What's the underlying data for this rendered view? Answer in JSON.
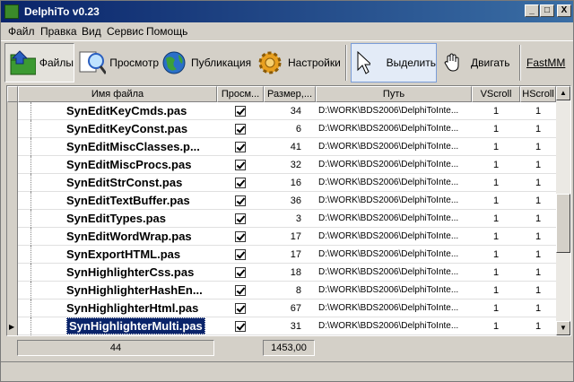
{
  "window": {
    "title": "DelphiTo v0.23",
    "min": "_",
    "max": "□",
    "close": "X"
  },
  "menu": [
    "Файл",
    "Правка",
    "Вид",
    "Сервис",
    "Помощь"
  ],
  "toolbar": {
    "files": "Файлы",
    "preview": "Просмотр",
    "publish": "Публикация",
    "settings": "Настройки",
    "select": "Выделить",
    "move": "Двигать",
    "fastmm": "FastMM"
  },
  "grid": {
    "headers": {
      "name": "Имя файла",
      "preview": "Просм...",
      "size": "Размер,...",
      "path": "Путь",
      "vscroll": "VScroll",
      "hscroll": "HScroll"
    },
    "rows": [
      {
        "name": "SynEditKeyCmds.pas",
        "checked": true,
        "size": "34",
        "path": "D:\\WORK\\BDS2006\\DelphiToInte...",
        "vs": "1",
        "hs": "1"
      },
      {
        "name": "SynEditKeyConst.pas",
        "checked": true,
        "size": "6",
        "path": "D:\\WORK\\BDS2006\\DelphiToInte...",
        "vs": "1",
        "hs": "1"
      },
      {
        "name": "SynEditMiscClasses.p...",
        "checked": true,
        "size": "41",
        "path": "D:\\WORK\\BDS2006\\DelphiToInte...",
        "vs": "1",
        "hs": "1"
      },
      {
        "name": "SynEditMiscProcs.pas",
        "checked": true,
        "size": "32",
        "path": "D:\\WORK\\BDS2006\\DelphiToInte...",
        "vs": "1",
        "hs": "1"
      },
      {
        "name": "SynEditStrConst.pas",
        "checked": true,
        "size": "16",
        "path": "D:\\WORK\\BDS2006\\DelphiToInte...",
        "vs": "1",
        "hs": "1"
      },
      {
        "name": "SynEditTextBuffer.pas",
        "checked": true,
        "size": "36",
        "path": "D:\\WORK\\BDS2006\\DelphiToInte...",
        "vs": "1",
        "hs": "1"
      },
      {
        "name": "SynEditTypes.pas",
        "checked": true,
        "size": "3",
        "path": "D:\\WORK\\BDS2006\\DelphiToInte...",
        "vs": "1",
        "hs": "1"
      },
      {
        "name": "SynEditWordWrap.pas",
        "checked": true,
        "size": "17",
        "path": "D:\\WORK\\BDS2006\\DelphiToInte...",
        "vs": "1",
        "hs": "1"
      },
      {
        "name": "SynExportHTML.pas",
        "checked": true,
        "size": "17",
        "path": "D:\\WORK\\BDS2006\\DelphiToInte...",
        "vs": "1",
        "hs": "1"
      },
      {
        "name": "SynHighlighterCss.pas",
        "checked": true,
        "size": "18",
        "path": "D:\\WORK\\BDS2006\\DelphiToInte...",
        "vs": "1",
        "hs": "1"
      },
      {
        "name": "SynHighlighterHashEn...",
        "checked": true,
        "size": "8",
        "path": "D:\\WORK\\BDS2006\\DelphiToInte...",
        "vs": "1",
        "hs": "1"
      },
      {
        "name": "SynHighlighterHtml.pas",
        "checked": true,
        "size": "67",
        "path": "D:\\WORK\\BDS2006\\DelphiToInte...",
        "vs": "1",
        "hs": "1"
      },
      {
        "name": "SynHighlighterMulti.pas",
        "checked": true,
        "size": "31",
        "path": "D:\\WORK\\BDS2006\\DelphiToInte...",
        "vs": "1",
        "hs": "1",
        "selected": true
      }
    ]
  },
  "footer": {
    "count": "44",
    "total": "1453,00"
  }
}
